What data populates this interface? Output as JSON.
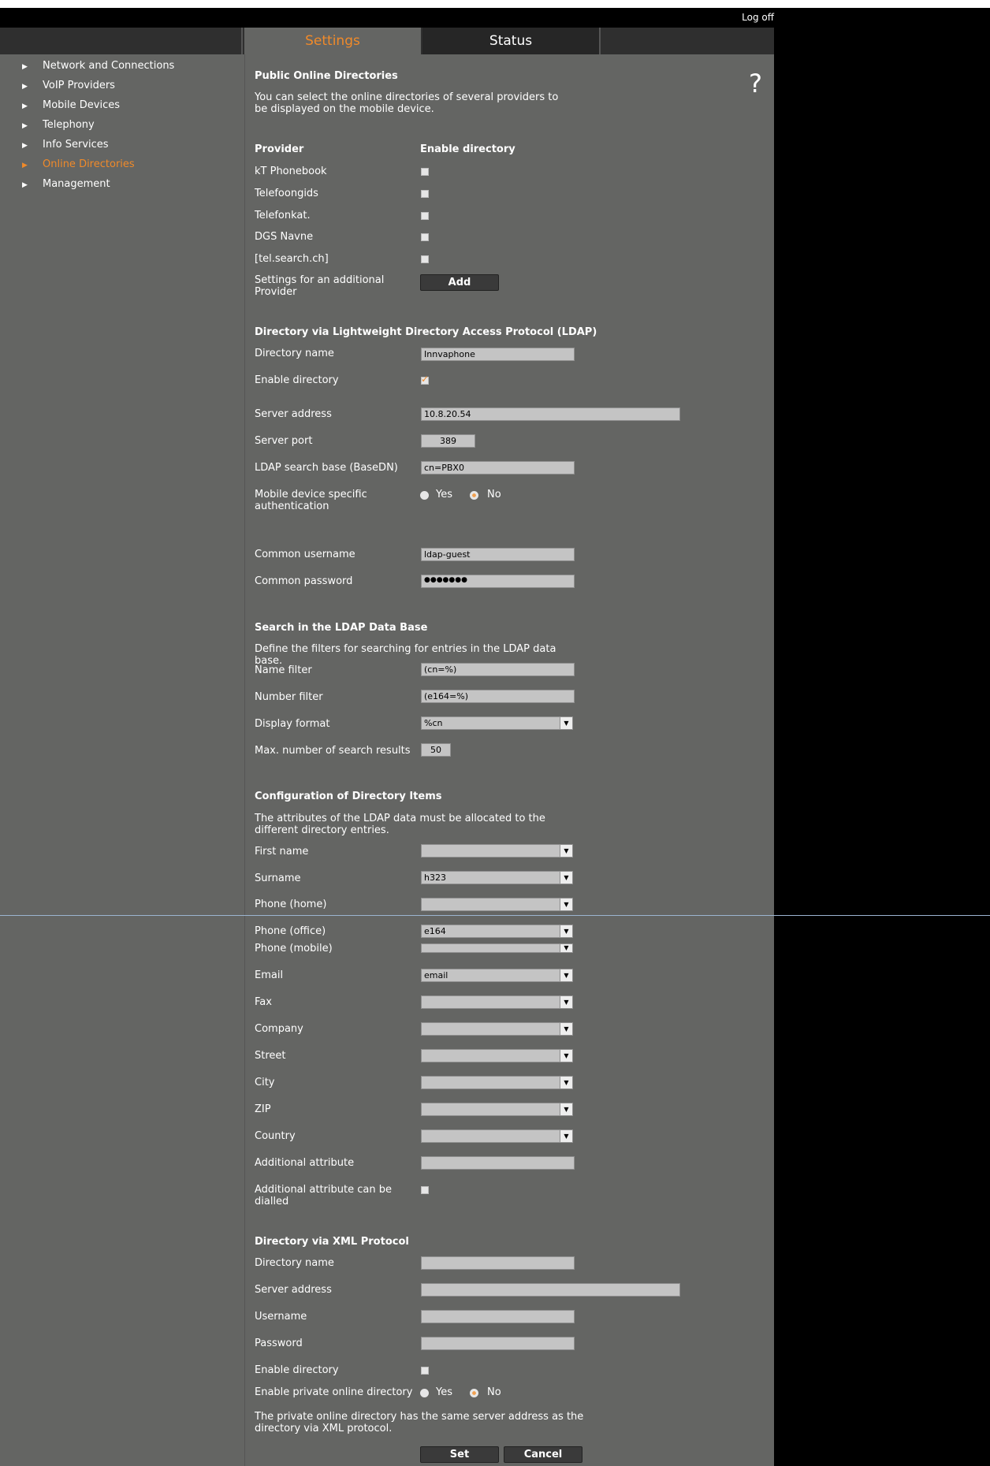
{
  "header": {
    "logoff": "Log off"
  },
  "tabs": {
    "settings": "Settings",
    "status": "Status"
  },
  "help_icon": "?",
  "sidebar": {
    "items": [
      {
        "label": "Network and Connections"
      },
      {
        "label": "VoIP Providers"
      },
      {
        "label": "Mobile Devices"
      },
      {
        "label": "Telephony"
      },
      {
        "label": "Info Services"
      },
      {
        "label": "Online Directories"
      },
      {
        "label": "Management"
      }
    ],
    "active": "Online Directories",
    "arrow": "▶"
  },
  "public": {
    "title": "Public Online Directories",
    "desc": "You can select the online directories of several providers to be displayed on the mobile device.",
    "col_provider": "Provider",
    "col_enable": "Enable directory",
    "providers": [
      {
        "name": "kT Phonebook",
        "enabled": false
      },
      {
        "name": "Telefoongids",
        "enabled": false
      },
      {
        "name": "Telefonkat.",
        "enabled": false
      },
      {
        "name": "DGS Navne",
        "enabled": false
      },
      {
        "name": "[tel.search.ch]",
        "enabled": false
      }
    ],
    "additional_label": "Settings for an additional Provider",
    "add_button": "Add"
  },
  "ldap": {
    "title": "Directory via Lightweight Directory Access Protocol (LDAP)",
    "dir_name_label": "Directory name",
    "dir_name": "Innvaphone",
    "enable_label": "Enable directory",
    "enabled": true,
    "server_label": "Server address",
    "server": "10.8.20.54",
    "port_label": "Server port",
    "port": "389",
    "base_label": "LDAP search base (BaseDN)",
    "base": "cn=PBX0",
    "mobile_auth_label": "Mobile device specific authentication",
    "yes": "Yes",
    "no": "No",
    "mobile_auth": "No",
    "user_label": "Common username",
    "user": "ldap-guest",
    "pass_label": "Common password",
    "pass": "●●●●●●●"
  },
  "search": {
    "title": "Search in the LDAP Data Base",
    "desc": "Define the filters for searching for entries in the LDAP data base.",
    "name_filter_label": "Name filter",
    "name_filter": "(cn=%)",
    "number_filter_label": "Number filter",
    "number_filter": "(e164=%)",
    "display_label": "Display format",
    "display": "%cn",
    "max_label": "Max. number of search results",
    "max": "50"
  },
  "config": {
    "title": "Configuration of Directory Items",
    "desc": "The attributes of the LDAP data must be allocated to the different directory entries.",
    "items": [
      {
        "label": "First name",
        "value": ""
      },
      {
        "label": "Surname",
        "value": "h323"
      },
      {
        "label": "Phone (home)",
        "value": ""
      },
      {
        "label": "Phone (office)",
        "value": "e164"
      },
      {
        "label": "Phone (mobile)",
        "value": ""
      },
      {
        "label": "Email",
        "value": "email"
      },
      {
        "label": "Fax",
        "value": ""
      },
      {
        "label": "Company",
        "value": ""
      },
      {
        "label": "Street",
        "value": ""
      },
      {
        "label": "City",
        "value": ""
      },
      {
        "label": "ZIP",
        "value": ""
      },
      {
        "label": "Country",
        "value": ""
      }
    ],
    "add_attr_label": "Additional attribute",
    "add_attr": "",
    "add_attr_dial_label": "Additional attribute can be dialled"
  },
  "xml": {
    "title": "Directory via XML Protocol",
    "dir_name_label": "Directory name",
    "dir_name": "",
    "server_label": "Server address",
    "server": "",
    "user_label": "Username",
    "user": "",
    "pass_label": "Password",
    "pass": "",
    "enable_label": "Enable directory",
    "private_label": "Enable private online directory",
    "yes": "Yes",
    "no": "No",
    "note": "The private online directory has the same server address as the directory via XML protocol."
  },
  "buttons": {
    "set": "Set",
    "cancel": "Cancel"
  }
}
